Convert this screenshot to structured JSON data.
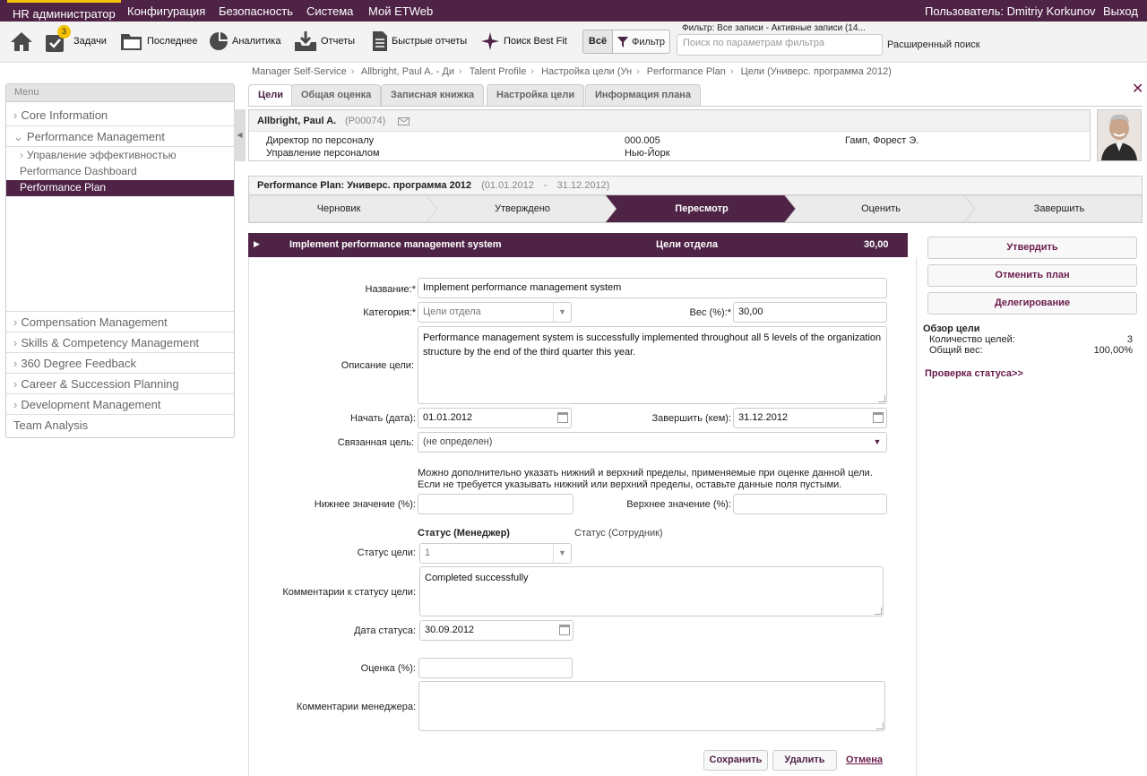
{
  "topnav": {
    "items": [
      "HR администратор",
      "Конфигурация",
      "Безопасность",
      "Система",
      "Мой ETWeb"
    ],
    "user": "Пользователь: Dmitriy Korkunov",
    "logout": "Выход"
  },
  "toolbar": {
    "tasks_count": "3",
    "tasks": "Задачи",
    "recent": "Последнее",
    "analytics": "Аналитика",
    "reports": "Отчеты",
    "quick_reports": "Быстрые отчеты",
    "best_fit": "Поиск Best Fit",
    "all": "Всё",
    "filter": "Фильтр",
    "filter_caption": "Фильтр: Все записи - Активные записи (14...",
    "filter_placeholder": "Поиск по параметрам фильтра",
    "advanced_search": "Расширенный поиск"
  },
  "breadcrumb": [
    "Manager Self-Service",
    "Allbright, Paul A. - Ди",
    "Talent Profile",
    "Настройка цели (Ун",
    "Performance Plan",
    "Цели (Универс. программа 2012)"
  ],
  "menu": {
    "header": "Menu",
    "core": "Core Information",
    "perf": "Performance Management",
    "perf_sub": "Управление эффективностью",
    "dashboard": "Performance Dashboard",
    "plan": "Performance Plan",
    "comp": "Compensation Management",
    "skills": "Skills & Competency Management",
    "feedback": "360 Degree Feedback",
    "career": "Career & Succession Planning",
    "dev": "Development Management",
    "team": "Team Analysis"
  },
  "tabs": [
    "Цели",
    "Общая оценка",
    "Записная книжка",
    "Настройка цели",
    "Информация плана"
  ],
  "employee": {
    "name": "Allbright, Paul A.",
    "id": "(P00074)",
    "title": "Директор по персоналу",
    "department": "Управление персоналом",
    "code": "000.005",
    "location": "Нью-Йорк",
    "manager": "Гамп, Форест Э."
  },
  "plan": {
    "label": "Performance Plan: Универс. программа 2012",
    "start": "(01.01.2012",
    "dash": "-",
    "end": "31.12.2012)"
  },
  "steps": [
    "Черновик",
    "Утверждено",
    "Пересмотр",
    "Оценить",
    "Завершить"
  ],
  "goal_bar": {
    "title": "Implement performance management system",
    "category": "Цели отдела",
    "weight": "30,00"
  },
  "form": {
    "name_label": "Название:*",
    "name_value": "Implement performance management system",
    "category_label": "Категория:*",
    "category_value": "Цели отдела",
    "weight_label": "Вес (%):*",
    "weight_value": "30,00",
    "description_label": "Описание цели:",
    "description_value": "Performance management system is successfully implemented throughout all 5 levels of the organization structure by the end of the third quarter this year.",
    "start_label": "Начать (дата):",
    "start_value": "01.01.2012",
    "end_label": "Завершить (кем):",
    "end_value": "31.12.2012",
    "linked_label": "Связанная цель:",
    "linked_value": "(не определен)",
    "hint_line1": "Можно дополнительно указать нижний и верхний пределы, применяемые при оценке данной цели.",
    "hint_line2": "Если не требуется указывать нижний или верхний пределы, оставьте данные поля пустыми.",
    "lower_label": "Нижнее значение (%):",
    "upper_label": "Верхнее значение (%):",
    "status_manager": "Статус (Менеджер)",
    "status_employee": "Статус (Сотрудник)",
    "status_label": "Статус цели:",
    "status_value": "1",
    "status_comment_label": "Комментарии к статусу цели:",
    "status_comment_value": "Completed successfully",
    "status_date_label": "Дата статуса:",
    "status_date_value": "30.09.2012",
    "rating_label": "Оценка (%):",
    "manager_comment_label": "Комментарии менеджера:",
    "save": "Сохранить",
    "delete": "Удалить",
    "cancel": "Отмена"
  },
  "right_panel": {
    "approve": "Утвердить",
    "cancel_plan": "Отменить план",
    "delegate": "Делегирование",
    "overview_title": "Обзор цели",
    "goal_count_label": "Количество целей:",
    "goal_count_value": "3",
    "total_weight_label": "Общий вес:",
    "total_weight_value": "100,00%",
    "status_check": "Проверка статуса>>"
  }
}
